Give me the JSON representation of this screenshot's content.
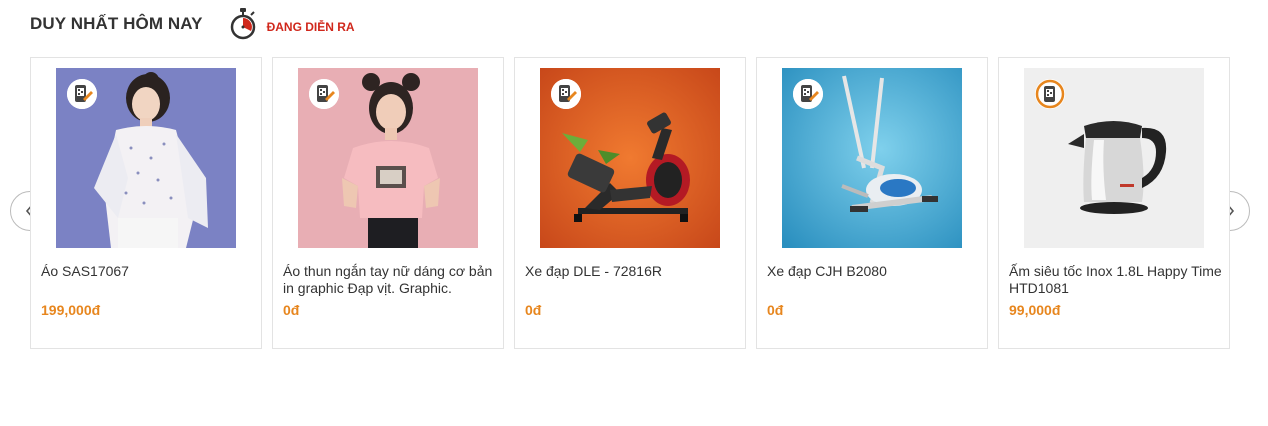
{
  "section": {
    "title": "DUY NHẤT HÔM NAY",
    "status": "ĐANG DIỄN RA",
    "timer_icon": "stopwatch-icon",
    "accent_color": "#d0281c",
    "price_color": "#e7861e"
  },
  "navigation": {
    "prev_icon": "chevron-left-icon",
    "next_icon": "chevron-right-icon"
  },
  "products": [
    {
      "name": "Áo SAS17067",
      "price": "199,000đ",
      "image": "woman-shirt-photo"
    },
    {
      "name": "Áo thun ngắn tay nữ dáng cơ bản in graphic Đạp vịt. Graphic.",
      "price": "0đ",
      "image": "pink-tshirt-photo"
    },
    {
      "name": "Xe đạp DLE - 72816R",
      "price": "0đ",
      "image": "exercise-bike-photo"
    },
    {
      "name": "Xe đạp CJH B2080",
      "price": "0đ",
      "image": "elliptical-trainer-photo"
    },
    {
      "name": "Ấm siêu tốc Inox 1.8L Happy Time  HTD1081",
      "price": "99,000đ",
      "image": "electric-kettle-photo"
    }
  ]
}
